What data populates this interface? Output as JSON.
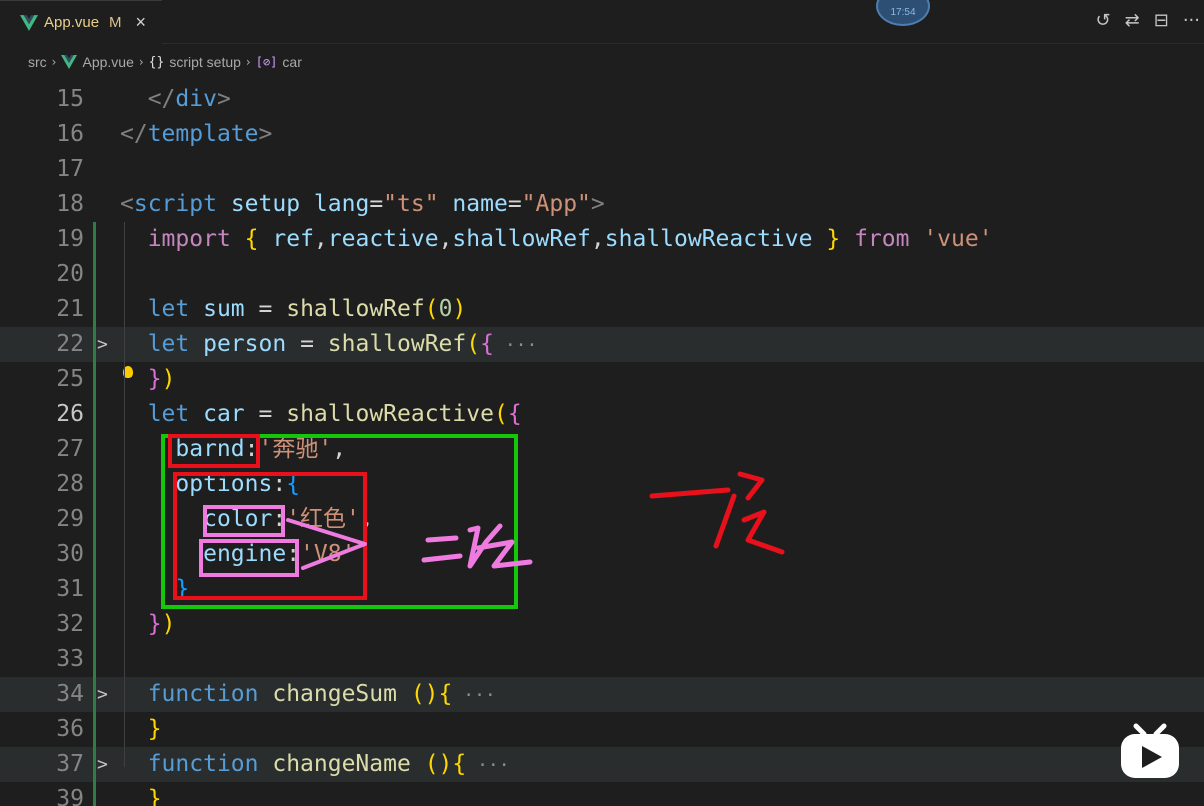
{
  "tab": {
    "filename": "App.vue",
    "modified_badge": "M",
    "close_glyph": "×"
  },
  "tab_actions": {
    "timeline_icon": "↺",
    "compare_icon": "⇄",
    "split_icon": "⊟",
    "more_icon": "···"
  },
  "timer_bubble": "17:54",
  "breadcrumb": {
    "folder": "src",
    "file": "App.vue",
    "scope": "script setup",
    "symbol": "car",
    "scope_icon": "{}",
    "symbol_icon": "[⊘]"
  },
  "lines": [
    {
      "num": "15",
      "tokens": [
        [
          "t-punc",
          "  </"
        ],
        [
          "t-tag",
          "div"
        ],
        [
          "t-punc",
          ">"
        ]
      ]
    },
    {
      "num": "16",
      "tokens": [
        [
          "t-punc",
          "</"
        ],
        [
          "t-tag",
          "template"
        ],
        [
          "t-punc",
          ">"
        ]
      ]
    },
    {
      "num": "17",
      "tokens": []
    },
    {
      "num": "18",
      "tokens": [
        [
          "t-punc",
          "<"
        ],
        [
          "t-tag",
          "script"
        ],
        [
          "t-txt",
          " "
        ],
        [
          "t-attr",
          "setup"
        ],
        [
          "t-txt",
          " "
        ],
        [
          "t-attr",
          "lang"
        ],
        [
          "t-op",
          "="
        ],
        [
          "t-str",
          "\"ts\""
        ],
        [
          "t-txt",
          " "
        ],
        [
          "t-attr",
          "name"
        ],
        [
          "t-op",
          "="
        ],
        [
          "t-str",
          "\"App\""
        ],
        [
          "t-punc",
          ">"
        ]
      ]
    },
    {
      "num": "19",
      "tokens": [
        [
          "t-txt",
          "  "
        ],
        [
          "t-imp",
          "import"
        ],
        [
          "t-txt",
          " "
        ],
        [
          "t-b1",
          "{"
        ],
        [
          "t-txt",
          " "
        ],
        [
          "t-var",
          "ref"
        ],
        [
          "t-txt",
          ","
        ],
        [
          "t-var",
          "reactive"
        ],
        [
          "t-txt",
          ","
        ],
        [
          "t-var",
          "shallowRef"
        ],
        [
          "t-txt",
          ","
        ],
        [
          "t-var",
          "shallowReactive"
        ],
        [
          "t-txt",
          " "
        ],
        [
          "t-b1",
          "}"
        ],
        [
          "t-txt",
          " "
        ],
        [
          "t-imp",
          "from"
        ],
        [
          "t-txt",
          " "
        ],
        [
          "t-str",
          "'vue'"
        ]
      ]
    },
    {
      "num": "20",
      "tokens": []
    },
    {
      "num": "21",
      "tokens": [
        [
          "t-txt",
          "  "
        ],
        [
          "t-kw",
          "let"
        ],
        [
          "t-txt",
          " "
        ],
        [
          "t-var",
          "sum"
        ],
        [
          "t-txt",
          " "
        ],
        [
          "t-op",
          "="
        ],
        [
          "t-txt",
          " "
        ],
        [
          "t-fn",
          "shallowRef"
        ],
        [
          "t-b1",
          "("
        ],
        [
          "t-num",
          "0"
        ],
        [
          "t-b1",
          ")"
        ]
      ]
    },
    {
      "num": "22",
      "fold": ">",
      "hl": true,
      "ellipsis": "···",
      "tokens": [
        [
          "t-txt",
          "  "
        ],
        [
          "t-kw",
          "let"
        ],
        [
          "t-txt",
          " "
        ],
        [
          "t-var",
          "person"
        ],
        [
          "t-txt",
          " "
        ],
        [
          "t-op",
          "="
        ],
        [
          "t-txt",
          " "
        ],
        [
          "t-fn",
          "shallowRef"
        ],
        [
          "t-b1",
          "("
        ],
        [
          "t-b2",
          "{"
        ]
      ]
    },
    {
      "num": "25",
      "bulb": true,
      "tokens": [
        [
          "t-txt",
          "  "
        ],
        [
          "t-b2",
          "}"
        ],
        [
          "t-b1",
          ")"
        ]
      ]
    },
    {
      "num": "26",
      "cur": true,
      "tokens": [
        [
          "t-txt",
          "  "
        ],
        [
          "t-kw",
          "let"
        ],
        [
          "t-txt",
          " "
        ],
        [
          "t-var",
          "car"
        ],
        [
          "t-txt",
          " "
        ],
        [
          "t-op",
          "="
        ],
        [
          "t-txt",
          " "
        ],
        [
          "t-fn",
          "shallowReactive"
        ],
        [
          "t-b1",
          "("
        ],
        [
          "t-b2",
          "{"
        ]
      ]
    },
    {
      "num": "27",
      "tokens": [
        [
          "t-txt",
          "    "
        ],
        [
          "t-prop",
          "barnd"
        ],
        [
          "t-txt",
          ":"
        ],
        [
          "t-str",
          "'奔驰'"
        ],
        [
          "t-txt",
          ","
        ]
      ]
    },
    {
      "num": "28",
      "tokens": [
        [
          "t-txt",
          "    "
        ],
        [
          "t-prop",
          "options"
        ],
        [
          "t-txt",
          ":"
        ],
        [
          "t-b3",
          "{"
        ]
      ]
    },
    {
      "num": "29",
      "tokens": [
        [
          "t-txt",
          "      "
        ],
        [
          "t-prop",
          "color"
        ],
        [
          "t-txt",
          ":"
        ],
        [
          "t-str",
          "'红色'"
        ],
        [
          "t-txt",
          ","
        ]
      ]
    },
    {
      "num": "30",
      "tokens": [
        [
          "t-txt",
          "      "
        ],
        [
          "t-prop",
          "engine"
        ],
        [
          "t-txt",
          ":"
        ],
        [
          "t-str",
          "'V8'"
        ]
      ]
    },
    {
      "num": "31",
      "tokens": [
        [
          "t-txt",
          "    "
        ],
        [
          "t-b3",
          "}"
        ]
      ]
    },
    {
      "num": "32",
      "tokens": [
        [
          "t-txt",
          "  "
        ],
        [
          "t-b2",
          "}"
        ],
        [
          "t-b1",
          ")"
        ]
      ]
    },
    {
      "num": "33",
      "tokens": []
    },
    {
      "num": "34",
      "fold": ">",
      "hl": true,
      "ellipsis": "···",
      "tokens": [
        [
          "t-txt",
          "  "
        ],
        [
          "t-kw",
          "function"
        ],
        [
          "t-txt",
          " "
        ],
        [
          "t-fn",
          "changeSum"
        ],
        [
          "t-txt",
          " "
        ],
        [
          "t-b1",
          "()"
        ],
        [
          "t-b1",
          "{"
        ]
      ]
    },
    {
      "num": "36",
      "tokens": [
        [
          "t-txt",
          "  "
        ],
        [
          "t-b1",
          "}"
        ]
      ]
    },
    {
      "num": "37",
      "fold": ">",
      "hl": true,
      "ellipsis": "···",
      "tokens": [
        [
          "t-txt",
          "  "
        ],
        [
          "t-kw",
          "function"
        ],
        [
          "t-txt",
          " "
        ],
        [
          "t-fn",
          "changeName"
        ],
        [
          "t-txt",
          " "
        ],
        [
          "t-b1",
          "()"
        ],
        [
          "t-b1",
          "{"
        ]
      ]
    },
    {
      "num": "39",
      "tokens": [
        [
          "t-txt",
          "  "
        ],
        [
          "t-b1",
          "}"
        ]
      ]
    }
  ],
  "colors": {
    "annot_green": "#16c60c",
    "annot_red": "#e8101a",
    "annot_pink": "#f07be0",
    "vue_green": "#41b883"
  },
  "icons": {
    "vue": "vue-logo-icon",
    "bilibili": "bilibili-tv-icon"
  }
}
